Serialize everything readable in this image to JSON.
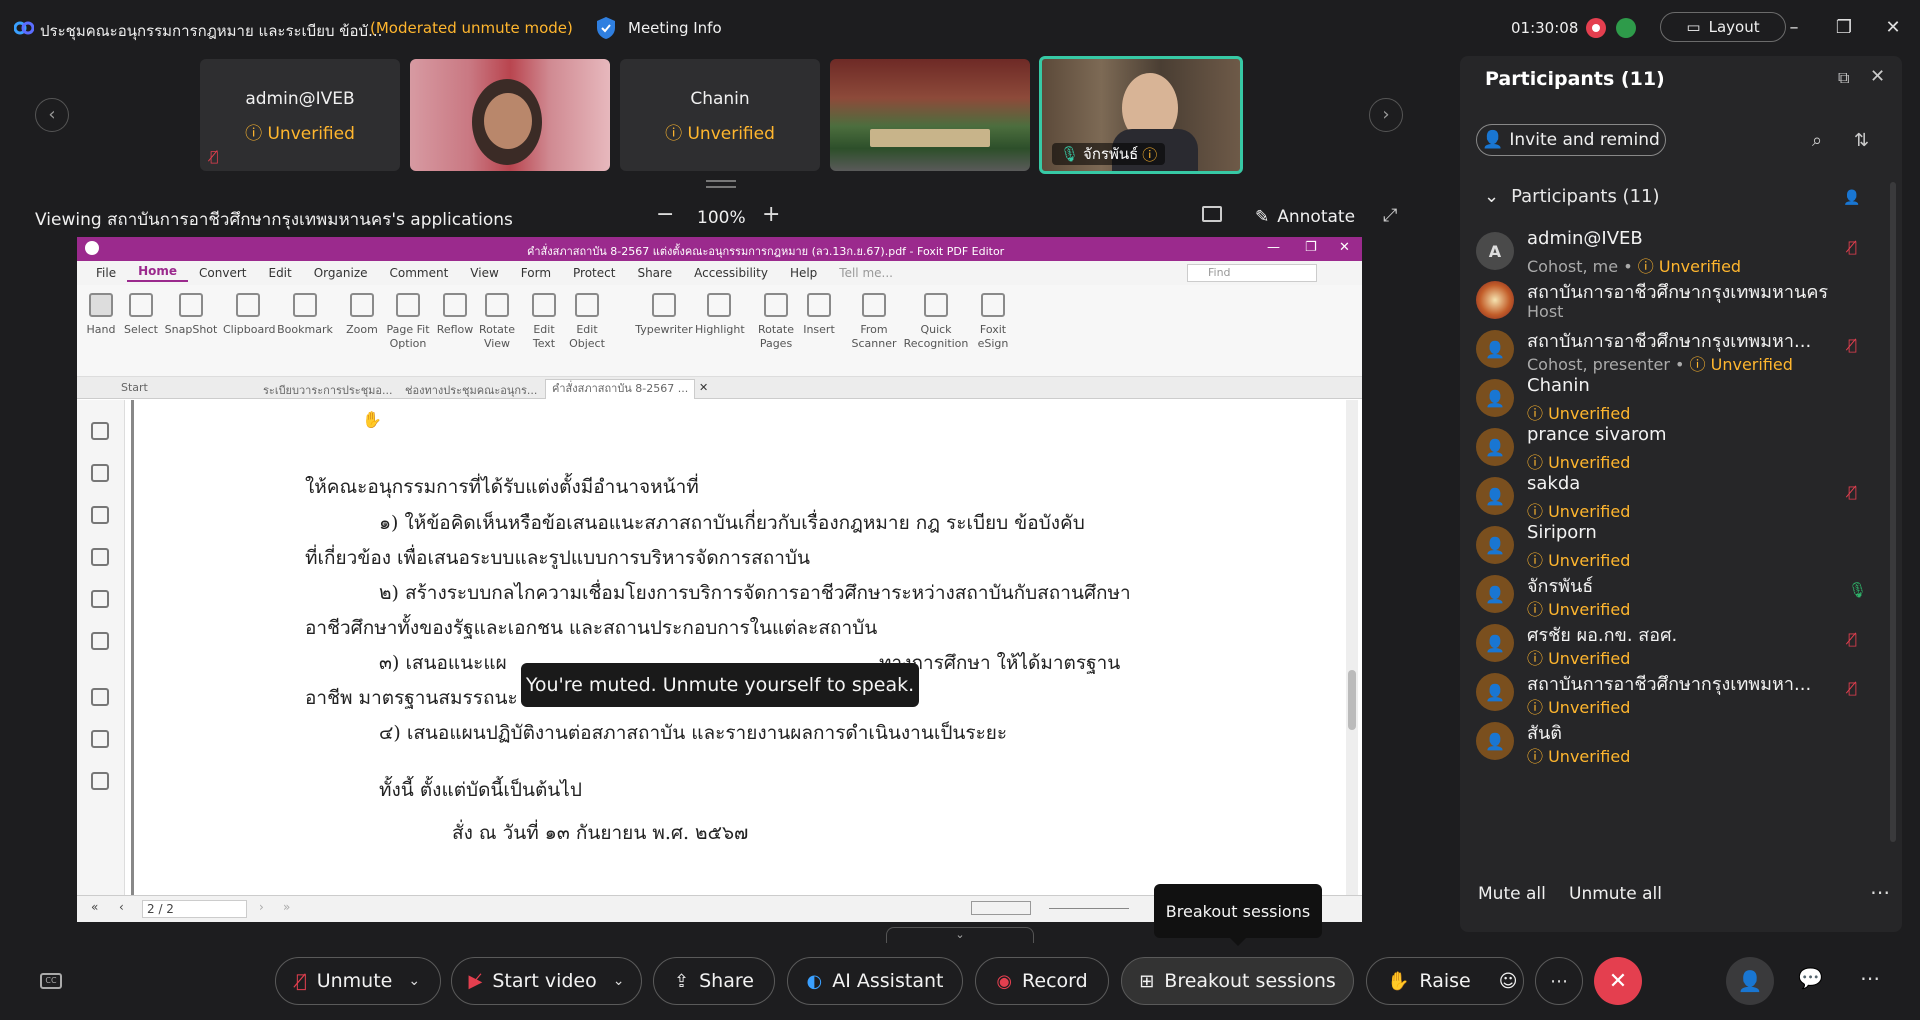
{
  "titlebar": {
    "meeting_title": "ประชุมคณะอนุกรรมการกฎหมาย และระเบียบ ข้อบั...",
    "mode": "(Moderated unmute mode)",
    "meeting_info": "Meeting Info",
    "timer": "01:30:08",
    "layout": "Layout",
    "minimize": "–",
    "restore": "❐",
    "close": "✕"
  },
  "strip": {
    "prev": "‹",
    "next": "›",
    "tiles": [
      {
        "name": "admin@IVEB",
        "status": "Unverified",
        "muted": true
      },
      {
        "name": "",
        "status": ""
      },
      {
        "name": "Chanin",
        "status": "Unverified"
      },
      {
        "name": "",
        "status": ""
      },
      {
        "name": "จักรพันธ์",
        "status": ""
      }
    ]
  },
  "share": {
    "viewing": "Viewing สถาบันการอาชีวศึกษากรุงเทพมหานคร's applications",
    "zoom_minus": "−",
    "zoom": "100%",
    "zoom_plus": "+",
    "annotate": "Annotate"
  },
  "app": {
    "window_title": "คำสั่งสภาสถาบัน 8-2567 แต่งตั้งคณะอนุกรรมการกฎหมาย (ลว.13ก.ย.67).pdf - Foxit PDF Editor",
    "menu": [
      "File",
      "Home",
      "Convert",
      "Edit",
      "Organize",
      "Comment",
      "View",
      "Form",
      "Protect",
      "Share",
      "Accessibility",
      "Help"
    ],
    "tell_me": "Tell me...",
    "find": "Find",
    "ribbon": [
      {
        "label": "Hand"
      },
      {
        "label": "Select"
      },
      {
        "label": "SnapShot"
      },
      {
        "label": "Clipboard"
      },
      {
        "label": "Bookmark"
      },
      {
        "label": "Zoom"
      },
      {
        "label": "Page Fit Option"
      },
      {
        "label": "Reflow"
      },
      {
        "label": "Rotate View"
      },
      {
        "label": "Edit Text"
      },
      {
        "label": "Edit Object"
      },
      {
        "label": "Typewriter"
      },
      {
        "label": "Highlight"
      },
      {
        "label": "Rotate Pages"
      },
      {
        "label": "Insert"
      },
      {
        "label": "From Scanner"
      },
      {
        "label": "Quick Recognition"
      },
      {
        "label": "Foxit eSign"
      }
    ],
    "tabs": [
      "Start",
      "ระเบียบวาระการประชุมอ...",
      "ช่องทางประชุมคณะอนุกร...",
      "คำสั่งสภาสถาบัน 8-2567 ..."
    ],
    "doc_lines": [
      "ให้คณะอนุกรรมการที่ได้รับแต่งตั้งมีอำนาจหน้าที่",
      "๑) ให้ข้อคิดเห็นหรือข้อเสนอแนะสภาสถาบันเกี่ยวกับเรื่องกฎหมาย กฎ ระเบียบ ข้อบังคับ",
      "ที่เกี่ยวข้อง เพื่อเสนอระบบและรูปแบบการบริหารจัดการสถาบัน",
      "๒) สร้างระบบกลไกความเชื่อมโยงการบริการจัดการอาชีวศึกษาระหว่างสถาบันกับสถานศึกษา",
      "อาชีวศึกษาทั้งของรัฐและเอกชน และสถานประกอบการในแต่ละสถาบัน",
      "๓) เสนอแนะแผ",
      "ทางการศึกษา ให้ได้มาตรฐาน",
      "อาชีพ มาตรฐานสมรรถนะ",
      "๔) เสนอแผนปฏิบัติงานต่อสภาสถาบัน และรายงานผลการดำเนินงานเป็นระยะ",
      "ทั้งนี้ ตั้งแต่บัดนี้เป็นต้นไป",
      "สั่ง ณ วันที่ ๑๓ กันยายน พ.ศ. ๒๕๖๗"
    ],
    "page_indicator": "2 / 2"
  },
  "toast": "You're muted. Unmute yourself to speak.",
  "tooltip": "Breakout sessions",
  "participants": {
    "title": "Participants (11)",
    "invite": "Invite and remind",
    "section": "Participants (11)",
    "rows": [
      {
        "name": "admin@IVEB",
        "role": "Cohost, me • ",
        "status": "Unverified",
        "avatar": "A",
        "mic": "off"
      },
      {
        "name": "สถาบันการอาชีวศึกษากรุงเทพมหานคร",
        "role": "Host",
        "status": "",
        "avatar": "",
        "mic": ""
      },
      {
        "name": "สถาบันการอาชีวศึกษากรุงเทพมหา...",
        "role": "Cohost, presenter • ",
        "status": "Unverified",
        "avatar": "",
        "mic": "off"
      },
      {
        "name": "Chanin",
        "role": "",
        "status": "Unverified",
        "avatar": "",
        "mic": ""
      },
      {
        "name": "prance sivarom",
        "role": "",
        "status": "Unverified",
        "avatar": "",
        "mic": ""
      },
      {
        "name": "sakda",
        "role": "",
        "status": "Unverified",
        "avatar": "",
        "mic": "off"
      },
      {
        "name": "Siriporn",
        "role": "",
        "status": "Unverified",
        "avatar": "",
        "mic": ""
      },
      {
        "name": "จักรพันธ์",
        "role": "",
        "status": "Unverified",
        "avatar": "",
        "mic": "on"
      },
      {
        "name": "ศรชัย ผอ.กข. สอศ.",
        "role": "",
        "status": "Unverified",
        "avatar": "",
        "mic": "off"
      },
      {
        "name": "สถาบันการอาชีวศึกษากรุงเทพมหา...",
        "role": "",
        "status": "Unverified",
        "avatar": "",
        "mic": "off"
      },
      {
        "name": "สันติ",
        "role": "",
        "status": "Unverified",
        "avatar": "",
        "mic": ""
      }
    ],
    "mute_all": "Mute all",
    "unmute_all": "Unmute all"
  },
  "toolbar": {
    "unmute": "Unmute",
    "start_video": "Start video",
    "share": "Share",
    "ai_assistant": "AI Assistant",
    "record": "Record",
    "breakout": "Breakout sessions",
    "raise": "Raise"
  },
  "colors": {
    "accent_orange": "#ffb62e",
    "danger_red": "#e43f4f",
    "foxit_purple": "#9b2a8d",
    "active_green": "#37c9a5"
  }
}
